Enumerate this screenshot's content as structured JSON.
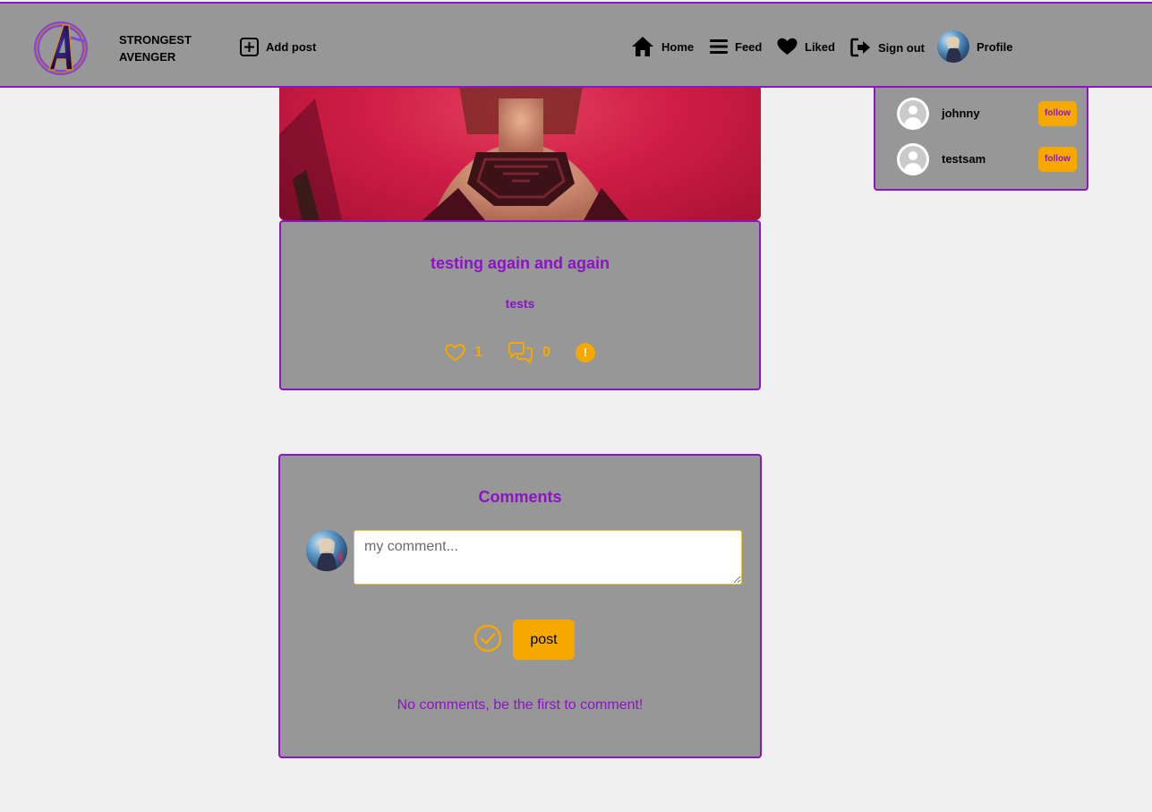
{
  "brand": {
    "line1": "STRONGEST",
    "line2": "AVENGER"
  },
  "nav": {
    "add_post": "Add post",
    "home": "Home",
    "feed": "Feed",
    "liked": "Liked",
    "sign_out": "Sign out",
    "profile": "Profile"
  },
  "post": {
    "title": "testing again and again",
    "tag": "tests",
    "likes": "1",
    "comments": "0",
    "report_symbol": "!"
  },
  "suggestions": [
    {
      "username": "johnny",
      "follow_label": "follow"
    },
    {
      "username": "testsam",
      "follow_label": "follow"
    }
  ],
  "comments_section": {
    "title": "Comments",
    "input_placeholder": "my comment...",
    "post_button": "post",
    "empty_message": "No comments, be the first to comment!"
  },
  "colors": {
    "accent_purple": "#8e12c6",
    "accent_orange": "#f5a800",
    "panel_gray": "#979797",
    "page_bg": "#f0f0f0"
  },
  "icons": [
    "avengers-logo-icon",
    "add-square-icon",
    "home-icon",
    "menu-icon",
    "heart-icon",
    "sign-out-icon",
    "heart-outline-icon",
    "comments-icon",
    "report-icon",
    "user-placeholder-icon",
    "check-circle-icon"
  ]
}
